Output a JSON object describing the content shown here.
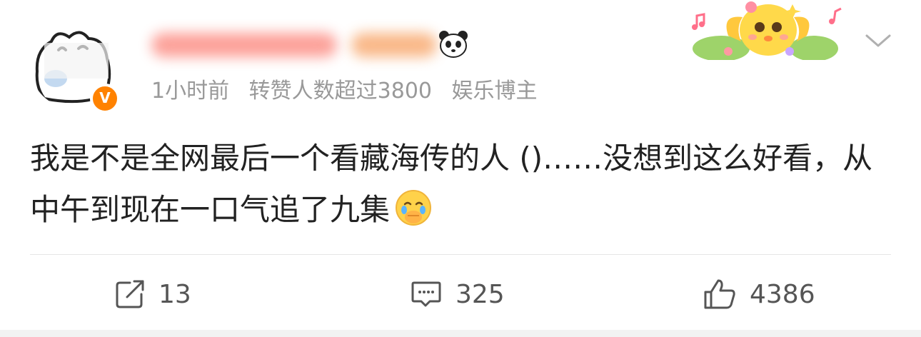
{
  "user": {
    "avatar_icon": "cartoon-dog-avatar",
    "verified_badge": "V",
    "verified_color": "#ff8200",
    "username_obscured": true,
    "username_emoji": "panda-icon"
  },
  "meta": {
    "time": "1小时前",
    "popularity": "转赞人数超过3800",
    "tag": "娱乐博主"
  },
  "post": {
    "text": "我是不是全网最后一个看藏海传的人 ()……没想到这么好看，从中午到现在一口气追了九集",
    "emoji": "crying-face-emoji"
  },
  "actions": {
    "repost_count": "13",
    "comment_count": "325",
    "like_count": "4386"
  },
  "colors": {
    "text": "#222222",
    "meta": "#999999",
    "action": "#555555",
    "divider": "#e6e6e6"
  }
}
